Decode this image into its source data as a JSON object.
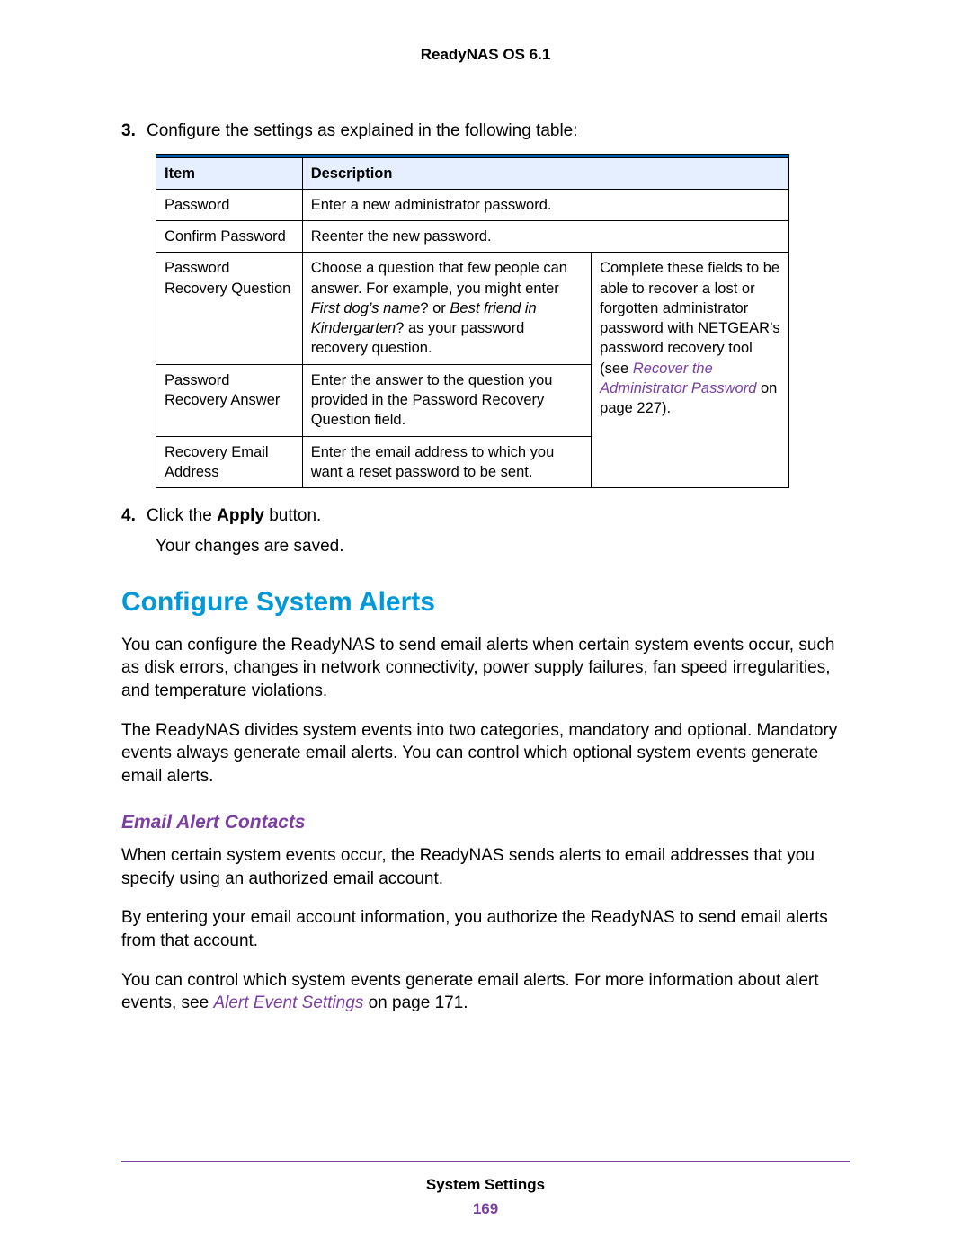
{
  "header": {
    "title": "ReadyNAS OS 6.1"
  },
  "steps": {
    "s3": {
      "num": "3.",
      "text": "Configure the settings as explained in the following table:"
    },
    "s4": {
      "num": "4.",
      "pre": "Click the ",
      "bold": "Apply",
      "post": " button.",
      "result": "Your changes are saved."
    }
  },
  "table": {
    "h_item": "Item",
    "h_desc": "Description",
    "r1": {
      "item": "Password",
      "desc": "Enter a new administrator password."
    },
    "r2": {
      "item": "Confirm Password",
      "desc": "Reenter the new password."
    },
    "r3": {
      "item": "Password Recovery Question",
      "desc_pre": "Choose a question that few people can answer. For example, you might enter ",
      "ex1": "First dog’s name",
      "mid": "? or ",
      "ex2": "Best friend in Kindergarten",
      "desc_post": "? as your password recovery question."
    },
    "r4": {
      "item": "Password Recovery Answer",
      "desc": "Enter the answer to the question you provided in the Password Recovery Question field."
    },
    "r5": {
      "item": "Recovery Email Address",
      "desc": "Enter the email address to which you want a reset password to be sent."
    },
    "merged": {
      "pre": "Complete these fields to be able to recover a lost or forgotten administrator password with NETGEAR’s password recovery tool (see ",
      "link": "Recover the Administrator Password",
      "post": " on page 227)."
    }
  },
  "section": {
    "heading": "Configure System Alerts",
    "p1": "You can configure the ReadyNAS to send email alerts when certain system events occur, such as disk errors, changes in network connectivity, power supply failures, fan speed irregularities, and temperature violations.",
    "p2": "The ReadyNAS divides system events into two categories, mandatory and optional. Mandatory events always generate email alerts. You can control which optional system events generate email alerts."
  },
  "subsection": {
    "heading": "Email Alert Contacts",
    "p1": "When certain system events occur, the ReadyNAS sends alerts to email addresses that you specify using an authorized email account.",
    "p2": "By entering your email account information, you authorize the ReadyNAS to send email alerts from that account.",
    "p3_pre": "You can control which system events generate email alerts. For more information about alert events, see ",
    "p3_link": "Alert Event Settings",
    "p3_post": " on page 171."
  },
  "footer": {
    "title": "System Settings",
    "page": "169"
  }
}
